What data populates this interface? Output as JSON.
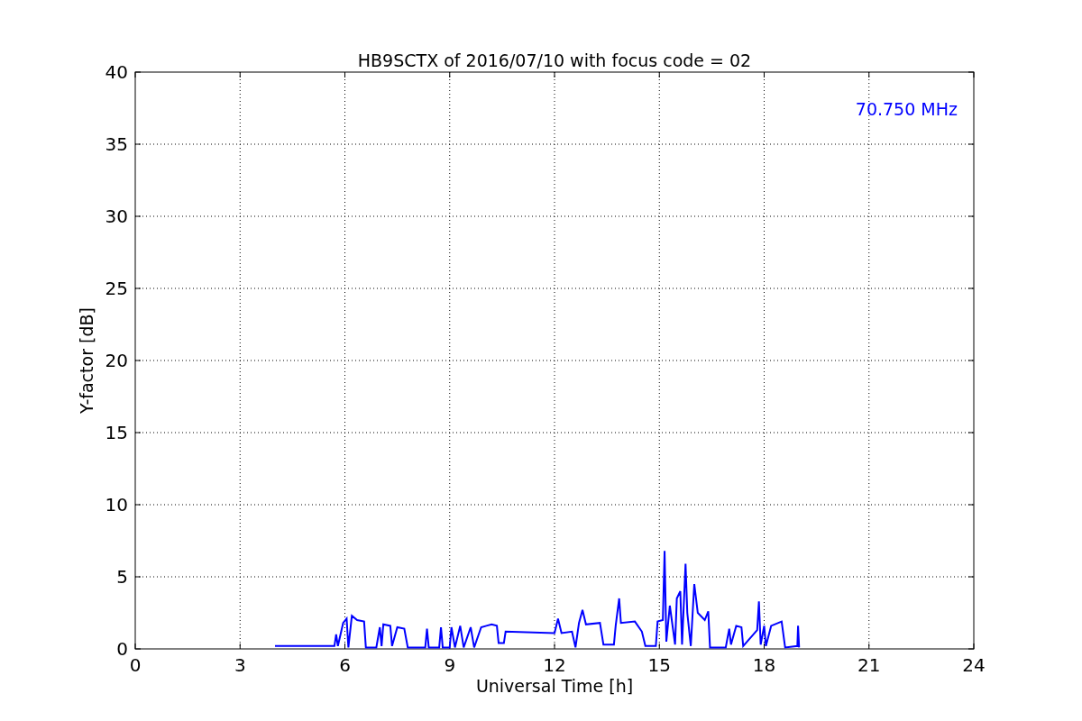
{
  "chart_data": {
    "type": "line",
    "title": "HB9SCTX of 2016/07/10 with focus code = 02",
    "xlabel": "Universal Time [h]",
    "ylabel": "Y-factor [dB]",
    "x": [
      4.0,
      5.7,
      5.75,
      5.8,
      5.95,
      6.05,
      6.1,
      6.2,
      6.35,
      6.55,
      6.6,
      6.9,
      7.0,
      7.05,
      7.1,
      7.3,
      7.35,
      7.5,
      7.7,
      7.8,
      8.3,
      8.35,
      8.4,
      8.7,
      8.75,
      8.8,
      9.0,
      9.05,
      9.15,
      9.3,
      9.4,
      9.6,
      9.7,
      9.9,
      10.05,
      10.2,
      10.35,
      10.4,
      10.55,
      10.6,
      12.0,
      12.1,
      12.2,
      12.5,
      12.6,
      12.7,
      12.8,
      12.9,
      13.3,
      13.4,
      13.7,
      13.75,
      13.85,
      13.9,
      14.3,
      14.5,
      14.6,
      14.9,
      14.95,
      15.1,
      15.15,
      15.2,
      15.3,
      15.45,
      15.5,
      15.6,
      15.65,
      15.75,
      15.8,
      15.9,
      16.0,
      16.1,
      16.3,
      16.4,
      16.45,
      16.9,
      17.0,
      17.05,
      17.2,
      17.35,
      17.4,
      17.8,
      17.85,
      17.9,
      18.0,
      18.05,
      18.2,
      18.5,
      18.6,
      18.95,
      18.97,
      19.0
    ],
    "series": [
      {
        "color": "#0000ff",
        "values": [
          0.2,
          0.2,
          1.0,
          0.2,
          1.8,
          2.1,
          0.1,
          2.3,
          2.0,
          1.9,
          0.1,
          0.1,
          1.5,
          0.2,
          1.7,
          1.6,
          0.2,
          1.5,
          1.4,
          0.1,
          0.1,
          1.4,
          0.1,
          0.1,
          1.5,
          0.1,
          0.1,
          1.5,
          0.1,
          1.6,
          0.1,
          1.5,
          0.1,
          1.5,
          1.6,
          1.7,
          1.6,
          0.4,
          0.4,
          1.2,
          1.1,
          2.1,
          1.1,
          1.2,
          0.1,
          1.8,
          2.7,
          1.7,
          1.8,
          0.3,
          0.3,
          1.6,
          3.5,
          1.8,
          1.9,
          1.2,
          0.2,
          0.2,
          1.9,
          2.0,
          6.8,
          0.5,
          3.0,
          0.3,
          3.5,
          4.0,
          0.3,
          5.9,
          2.5,
          0.2,
          4.5,
          2.5,
          2.0,
          2.6,
          0.1,
          0.1,
          1.4,
          0.3,
          1.6,
          1.5,
          0.2,
          1.3,
          3.3,
          0.3,
          1.6,
          0.2,
          1.6,
          1.9,
          0.1,
          0.2,
          1.6,
          0.1
        ]
      }
    ],
    "xlim": [
      0,
      24
    ],
    "ylim": [
      0,
      40
    ],
    "xticks": [
      0,
      3,
      6,
      9,
      12,
      15,
      18,
      21,
      24
    ],
    "yticks": [
      0,
      5,
      10,
      15,
      20,
      25,
      30,
      35,
      40
    ],
    "grid": true,
    "annotations": [
      "70.750 MHz"
    ]
  }
}
